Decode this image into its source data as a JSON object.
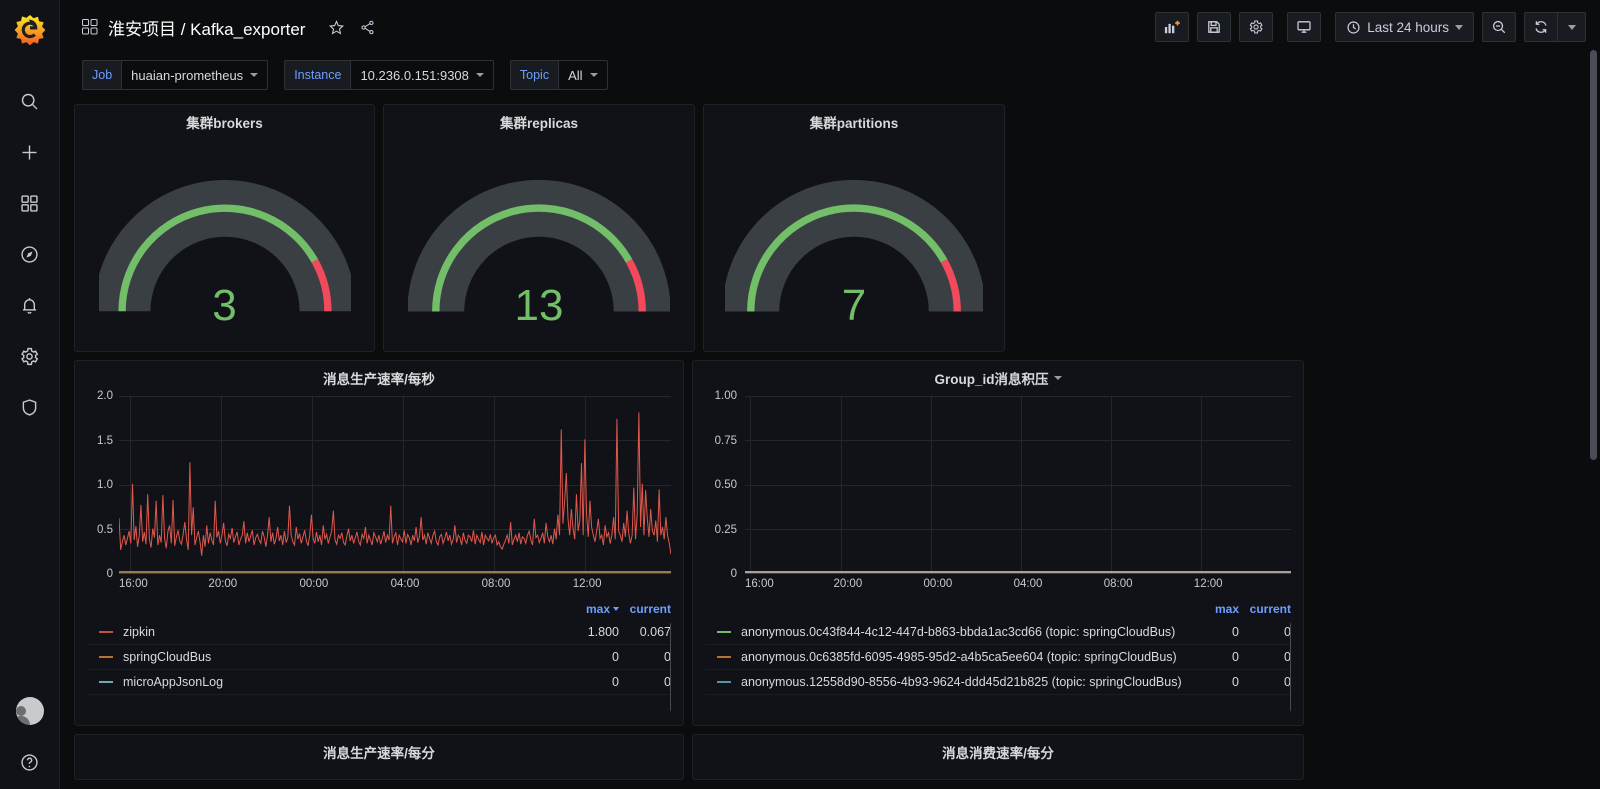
{
  "brand": {
    "logo": "grafana-logo"
  },
  "sidebar": {
    "items": [
      {
        "name": "search-icon",
        "label": "Search"
      },
      {
        "name": "create-icon",
        "label": "Create"
      },
      {
        "name": "dashboards-icon",
        "label": "Dashboards"
      },
      {
        "name": "explore-icon",
        "label": "Explore"
      },
      {
        "name": "alerting-icon",
        "label": "Alerting"
      },
      {
        "name": "configuration-icon",
        "label": "Configuration"
      },
      {
        "name": "server-admin-icon",
        "label": "Server Admin"
      }
    ],
    "bottom": [
      {
        "name": "user-avatar",
        "label": "User"
      },
      {
        "name": "help-icon",
        "label": "Help"
      }
    ]
  },
  "header": {
    "folder": "淮安项目",
    "separator": "/",
    "dashboard": "Kafka_exporter",
    "title": "淮安项目 / Kafka_exporter",
    "star_label": "Mark as favorite",
    "share_label": "Share dashboard",
    "actions": {
      "add_panel": "Add panel",
      "save": "Save dashboard",
      "settings": "Dashboard settings",
      "tv_mode": "Cycle view mode",
      "zoom_out": "Zoom out time range",
      "refresh": "Refresh dashboard",
      "refresh_interval": "Refresh interval"
    },
    "time_range": "Last 24 hours"
  },
  "variables": [
    {
      "label": "Job",
      "value": "huaian-prometheus"
    },
    {
      "label": "Instance",
      "value": "10.236.0.151:9308"
    },
    {
      "label": "Topic",
      "value": "All"
    }
  ],
  "gauges": [
    {
      "title": "集群brokers",
      "value": "3"
    },
    {
      "title": "集群replicas",
      "value": "13"
    },
    {
      "title": "集群partitions",
      "value": "7"
    }
  ],
  "panels": {
    "produce_rate_sec": {
      "title": "消息生产速率/每秒",
      "legend_headers": {
        "max": "max",
        "current": "current"
      },
      "series": [
        {
          "name": "zipkin",
          "color": "#c4513f",
          "max": "1.800",
          "current": "0.067"
        },
        {
          "name": "springCloudBus",
          "color": "#b87333",
          "max": "0",
          "current": "0"
        },
        {
          "name": "microAppJsonLog",
          "color": "#6fa8b5",
          "max": "0",
          "current": "0"
        }
      ]
    },
    "group_lag": {
      "title": "Group_id消息积压",
      "legend_headers": {
        "max": "max",
        "current": "current"
      },
      "series": [
        {
          "name": "anonymous.0c43f844-4c12-447d-b863-bbda1ac3cd66 (topic: springCloudBus)",
          "color": "#73bf69",
          "max": "0",
          "current": "0"
        },
        {
          "name": "anonymous.0c6385fd-6095-4985-95d2-a4b5ca5ee604 (topic: springCloudBus)",
          "color": "#b87333",
          "max": "0",
          "current": "0"
        },
        {
          "name": "anonymous.12558d90-8556-4b93-9624-ddd45d21b825 (topic: springCloudBus)",
          "color": "#5794a8",
          "max": "0",
          "current": "0"
        }
      ]
    },
    "produce_rate_min": {
      "title": "消息生产速率/每分"
    },
    "consume_rate_min": {
      "title": "消息消费速率/每分"
    }
  },
  "chart_data": [
    {
      "type": "line",
      "title": "消息生产速率/每秒",
      "xlabel": "",
      "ylabel": "",
      "ylim": [
        0,
        2.0
      ],
      "yticks": [
        "0",
        "0.5",
        "1.0",
        "1.5",
        "2.0"
      ],
      "xticks": [
        "16:00",
        "20:00",
        "00:00",
        "04:00",
        "08:00",
        "12:00"
      ],
      "grid": true,
      "legend_position": "bottom",
      "series": [
        {
          "name": "zipkin",
          "color": "#e0584d",
          "max": 1.8,
          "current": 0.067,
          "values": [
            0.51,
            0.12,
            0.22,
            0.3,
            0.18,
            0.26,
            0.35,
            0.2,
            0.93,
            0.24,
            0.41,
            0.16,
            0.29,
            0.67,
            0.22,
            0.34,
            0.19,
            0.8,
            0.25,
            0.15,
            0.38,
            0.27,
            0.72,
            0.18,
            0.3,
            0.21,
            0.79,
            0.26,
            0.14,
            0.35,
            0.42,
            0.2,
            0.73,
            0.17,
            0.28,
            0.36,
            0.23,
            0.19,
            0.31,
            0.46,
            0.25,
            0.12,
            1.19,
            0.3,
            0.64,
            0.18,
            0.27,
            0.35,
            0.22,
            0.05,
            0.3,
            0.16,
            0.42,
            0.2,
            0.33,
            0.24,
            0.18,
            0.72,
            0.27,
            0.35,
            0.2,
            0.3,
            0.45,
            0.23,
            0.17,
            0.31,
            0.26,
            0.39,
            0.21,
            0.28,
            0.34,
            0.18,
            0.25,
            0.3,
            0.47,
            0.2,
            0.33,
            0.22,
            0.29,
            0.36,
            0.18,
            0.27,
            0.31,
            0.24,
            0.2,
            0.35,
            0.28,
            0.16,
            0.3,
            0.52,
            0.22,
            0.33,
            0.19,
            0.26,
            0.4,
            0.23,
            0.3,
            0.18,
            0.35,
            0.21,
            0.27,
            0.66,
            0.3,
            0.22,
            0.18,
            0.4,
            0.25,
            0.32,
            0.2,
            0.28,
            0.36,
            0.23,
            0.17,
            0.3,
            0.55,
            0.26,
            0.2,
            0.34,
            0.22,
            0.3,
            0.18,
            0.42,
            0.25,
            0.31,
            0.2,
            0.28,
            0.35,
            0.6,
            0.24,
            0.19,
            0.3,
            0.26,
            0.33,
            0.21,
            0.18,
            0.29,
            0.38,
            0.23,
            0.3,
            0.2,
            0.27,
            0.34,
            0.22,
            0.18,
            0.31,
            0.26,
            0.4,
            0.2,
            0.3,
            0.24,
            0.18,
            0.33,
            0.28,
            0.22,
            0.3,
            0.19,
            0.26,
            0.35,
            0.21,
            0.3,
            0.24,
            0.66,
            0.2,
            0.28,
            0.33,
            0.18,
            0.3,
            0.25,
            0.22,
            0.36,
            0.2,
            0.31,
            0.27,
            0.18,
            0.3,
            0.23,
            0.4,
            0.21,
            0.28,
            0.52,
            0.24,
            0.3,
            0.19,
            0.33,
            0.26,
            0.2,
            0.3,
            0.35,
            0.22,
            0.18,
            0.28,
            0.31,
            0.2,
            0.26,
            0.34,
            0.23,
            0.3,
            0.19,
            0.25,
            0.42,
            0.21,
            0.3,
            0.27,
            0.18,
            0.33,
            0.24,
            0.2,
            0.3,
            0.28,
            0.22,
            0.36,
            0.19,
            0.3,
            0.25,
            0.21,
            0.34,
            0.18,
            0.3,
            0.26,
            0.23,
            0.31,
            0.2,
            0.27,
            0.3,
            0.18,
            0.22,
            0.16,
            0.13,
            0.19,
            0.24,
            0.3,
            0.2,
            0.46,
            0.18,
            0.25,
            0.3,
            0.22,
            0.33,
            0.19,
            0.28,
            0.26,
            0.2,
            0.3,
            0.35,
            0.24,
            0.18,
            0.5,
            0.27,
            0.3,
            0.21,
            0.26,
            0.33,
            0.2,
            0.45,
            0.28,
            0.22,
            0.3,
            0.19,
            0.38,
            0.25,
            0.55,
            0.3,
            1.59,
            0.44,
            0.7,
            1.06,
            0.5,
            0.3,
            0.62,
            0.38,
            0.25,
            0.8,
            0.35,
            0.48,
            1.18,
            0.3,
            1.47,
            0.55,
            0.28,
            0.72,
            0.4,
            0.3,
            0.22,
            0.35,
            0.5,
            0.26,
            0.3,
            0.18,
            0.42,
            0.28,
            0.33,
            0.2,
            0.3,
            0.52,
            0.25,
            1.72,
            0.35,
            0.3,
            0.22,
            0.45,
            0.28,
            0.6,
            0.32,
            0.2,
            0.3,
            0.88,
            0.25,
            0.55,
            1.8,
            0.4,
            0.93,
            0.3,
            0.85,
            0.5,
            0.28,
            0.62,
            0.35,
            0.3,
            0.48,
            0.22,
            0.86,
            0.3,
            0.4,
            0.25,
            0.52,
            0.3,
            0.2,
            0.067
          ]
        },
        {
          "name": "springCloudBus",
          "color": "#b87333",
          "max": 0,
          "current": 0,
          "values": []
        },
        {
          "name": "microAppJsonLog",
          "color": "#6fa8b5",
          "max": 0,
          "current": 0,
          "values": []
        }
      ]
    },
    {
      "type": "line",
      "title": "Group_id消息积压",
      "xlabel": "",
      "ylabel": "",
      "ylim": [
        0,
        1.0
      ],
      "yticks": [
        "0",
        "0.25",
        "0.50",
        "0.75",
        "1.00"
      ],
      "xticks": [
        "16:00",
        "20:00",
        "00:00",
        "04:00",
        "08:00",
        "12:00"
      ],
      "grid": true,
      "legend_position": "bottom",
      "series": [
        {
          "name": "anonymous.0c43f844-4c12-447d-b863-bbda1ac3cd66 (topic: springCloudBus)",
          "color": "#73bf69",
          "max": 0,
          "current": 0,
          "values": [
            0,
            0,
            0,
            0,
            0,
            0,
            0,
            0,
            0,
            0
          ]
        },
        {
          "name": "anonymous.0c6385fd-6095-4985-95d2-a4b5ca5ee604 (topic: springCloudBus)",
          "color": "#b87333",
          "max": 0,
          "current": 0,
          "values": [
            0,
            0,
            0,
            0,
            0,
            0,
            0,
            0,
            0,
            0
          ]
        },
        {
          "name": "anonymous.12558d90-8556-4b93-9624-ddd45d21b825 (topic: springCloudBus)",
          "color": "#5794a8",
          "max": 0,
          "current": 0,
          "values": [
            0,
            0,
            0,
            0,
            0,
            0,
            0,
            0,
            0,
            0
          ]
        }
      ]
    }
  ],
  "colors": {
    "gauge_ok": "#73bf69",
    "gauge_alert": "#f2495c",
    "gauge_track": "#3a3f44",
    "accent_blue": "#6e9fff",
    "panel_bg": "#111217",
    "page_bg": "#0b0c0e"
  }
}
